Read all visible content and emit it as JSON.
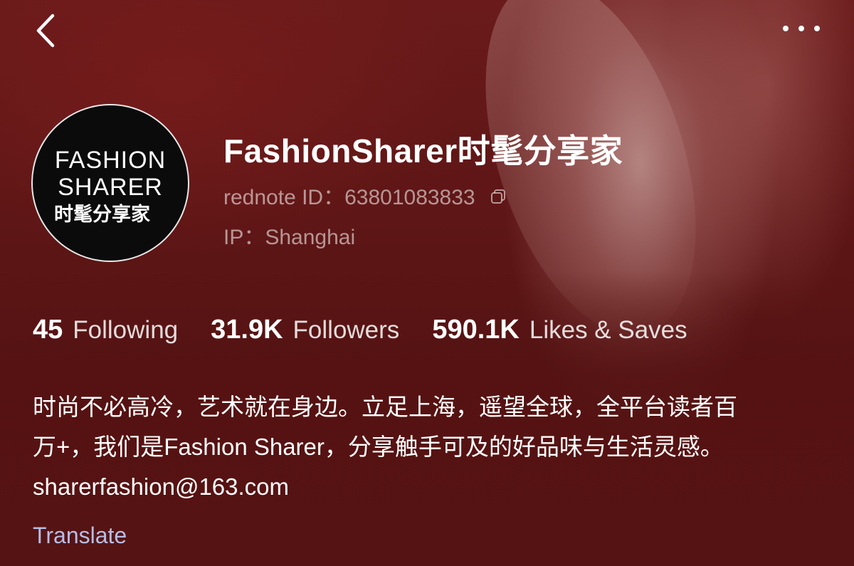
{
  "header": {
    "back_icon": "chevron-left-icon",
    "more_icon": "more-dots-icon"
  },
  "profile": {
    "avatar": {
      "line1": "FASHION",
      "line2": "SHARER",
      "line3": "时髦分享家"
    },
    "name": "FashionSharer时髦分享家",
    "id_text": "rednote ID：63801083833",
    "copy_icon": "copy-icon",
    "ip_text": "IP：Shanghai"
  },
  "stats": [
    {
      "number": "45",
      "label": "Following"
    },
    {
      "number": "31.9K",
      "label": "Followers"
    },
    {
      "number": "590.1K",
      "label": "Likes & Saves"
    }
  ],
  "bio": {
    "line1": "时尚不必高冷，艺术就在身边。立足上海，遥望全球，全平台读者百",
    "line2": "万+，我们是Fashion Sharer，分享触手可及的好品味与生活灵感。",
    "line3": "sharerfashion@163.com"
  },
  "translate_label": "Translate",
  "colors": {
    "background": "#5a1414",
    "translate_link": "#b6bde6"
  }
}
